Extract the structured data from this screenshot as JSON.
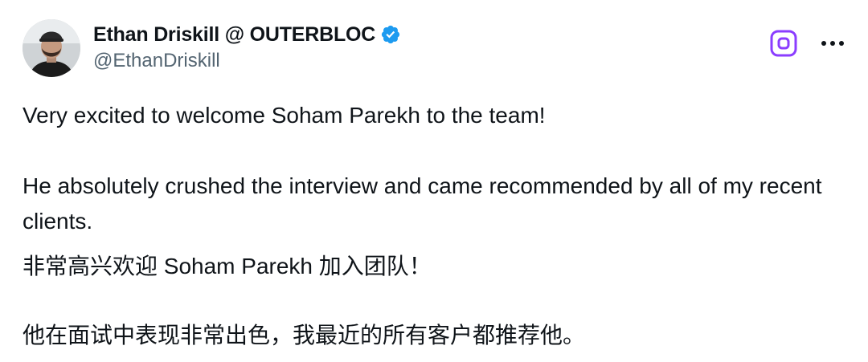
{
  "author": {
    "display_name": "Ethan Driskill @ OUTERBLOC",
    "handle": "@EthanDriskill",
    "avatar_icon": "profile-photo",
    "verified_icon": "verified-badge-icon",
    "verified_color": "#1d9bf0"
  },
  "actions": {
    "grok_icon": "grok-icon",
    "grok_color": "#8b3dff",
    "more_icon": "more-dots-icon"
  },
  "tweet": {
    "paragraphs": [
      "Very excited to welcome Soham Parekh to the team!",
      "He absolutely crushed the interview and came recommended by all of my recent clients.",
      "非常高兴欢迎 Soham Parekh 加入团队！",
      "他在面试中表现非常出色，我最近的所有客户都推荐他。"
    ]
  },
  "colors": {
    "text": "#0f1419",
    "secondary": "#536471",
    "background": "#ffffff"
  }
}
